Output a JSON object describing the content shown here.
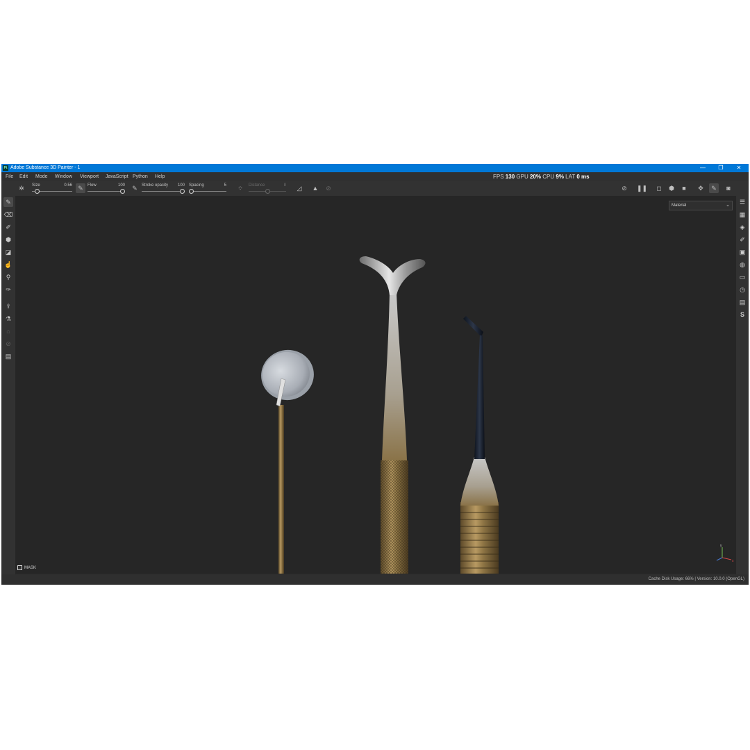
{
  "window": {
    "app_icon_text": "Pt",
    "title": "Adobe Substance 3D Painter - 1",
    "minimize": "—",
    "maximize": "❐",
    "close": "✕"
  },
  "menu": {
    "items": [
      {
        "label": "File"
      },
      {
        "label": "Edit"
      },
      {
        "label": "Mode"
      },
      {
        "label": "Window"
      },
      {
        "label": "Viewport"
      },
      {
        "label": "JavaScript"
      },
      {
        "label": "Python"
      },
      {
        "label": "Help"
      }
    ]
  },
  "perf": {
    "fps_label": "FPS",
    "fps_value": "130",
    "gpu_label": "GPU",
    "gpu_value": "20",
    "cpu_label": "CPU",
    "cpu_value": "9",
    "percent": "%",
    "lat_label": "LAT",
    "lat_value": "0",
    "lat_unit": "ms"
  },
  "toolbar": {
    "size": {
      "label": "Size",
      "value": "0.56",
      "level": 0.08
    },
    "flow": {
      "label": "Flow",
      "value": "100",
      "level": 1.0
    },
    "stroke_opacity": {
      "label": "Stroke opacity",
      "value": "100",
      "level": 1.0
    },
    "spacing": {
      "label": "Spacing",
      "value": "5",
      "level": 0.0
    },
    "distance": {
      "label": "Distance",
      "value": "8",
      "level": 0.5
    }
  },
  "viewport": {
    "material_dropdown": "Material",
    "mask_label": "MASK",
    "axis_labels": {
      "y": "y",
      "x": "x"
    }
  },
  "status": {
    "cache_label": "Cache Disk Usage:",
    "cache_value": "66%",
    "version": "| Version: 10.0.0 (OpenGL)"
  },
  "icons": {
    "left_tools": [
      "paint-brush-icon",
      "eraser-icon",
      "projection-icon",
      "geometry-fill-icon",
      "polygon-fill-icon",
      "smudge-icon",
      "clone-icon",
      "color-picker-icon",
      "bake-icon",
      "material-picker-icon",
      "export-icon",
      "iray-icon",
      "snapshot-icon"
    ],
    "right_panels": [
      "layers-icon",
      "texture-set-icon",
      "shelf-icon",
      "properties-icon",
      "display-settings-icon",
      "environment-icon",
      "assets-icon",
      "history-icon",
      "log-icon",
      "substance-icon"
    ]
  },
  "colors": {
    "title_bar": "#0078d7",
    "viewport_bg": "#262626",
    "panel_bg": "#323232",
    "metal_light": "#c9c9c9",
    "metal_gold": "#9a8050",
    "probe_tip": "#1a2230"
  }
}
